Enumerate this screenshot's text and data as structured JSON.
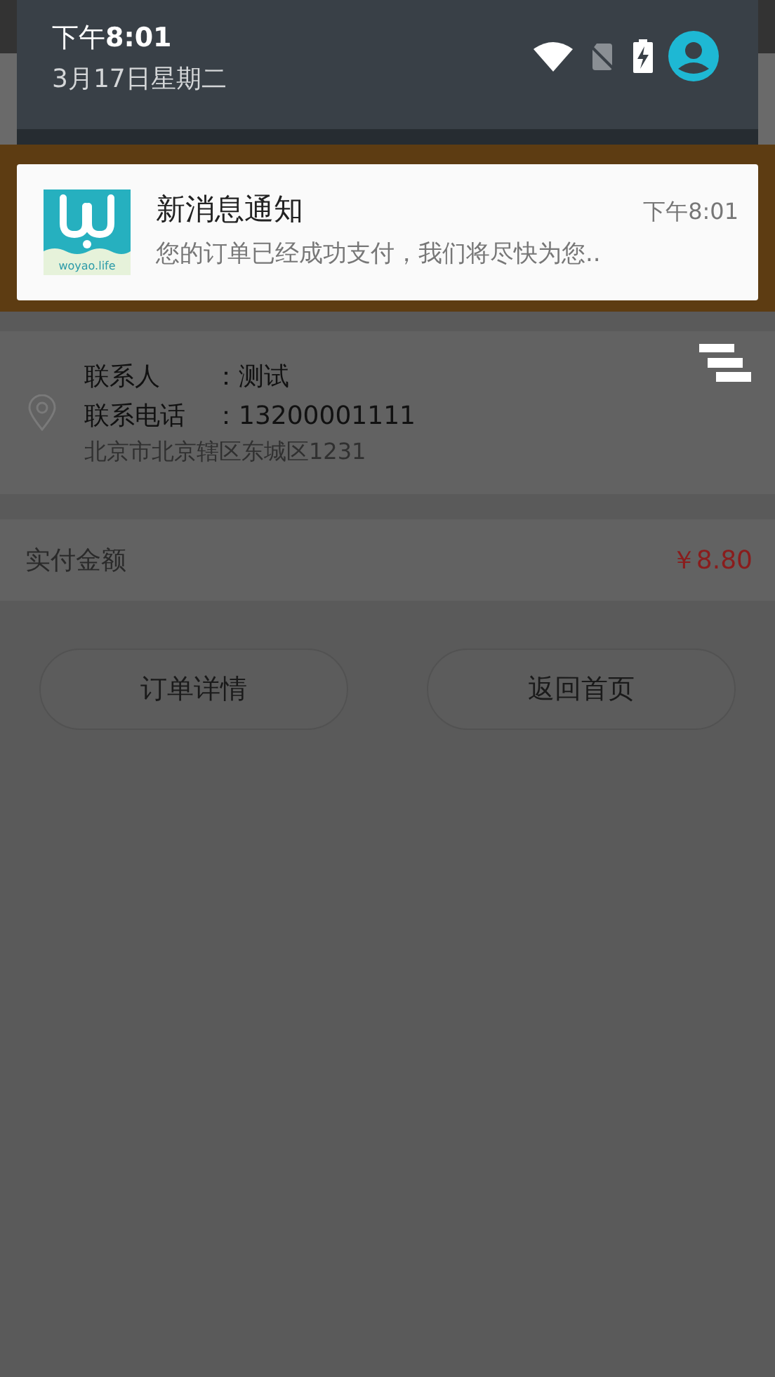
{
  "quick_settings": {
    "time": "下午**8:01**",
    "date": "3月17日星期二"
  },
  "notification": {
    "app_icon_caption": "woyao.life",
    "title": "新消息通知",
    "time": "下午8:01",
    "text": "您的订单已经成功支付，我们将尽快为您.."
  },
  "contact": {
    "rows": [
      {
        "label": "联系人",
        "value": "：测试"
      },
      {
        "label": "联系电话",
        "value": "：13200001111"
      }
    ],
    "address": "北京市北京辖区东城区1231"
  },
  "amount": {
    "label": "实付金额",
    "value": "￥8.80"
  },
  "buttons": [
    "订单详情",
    "返回首页"
  ]
}
